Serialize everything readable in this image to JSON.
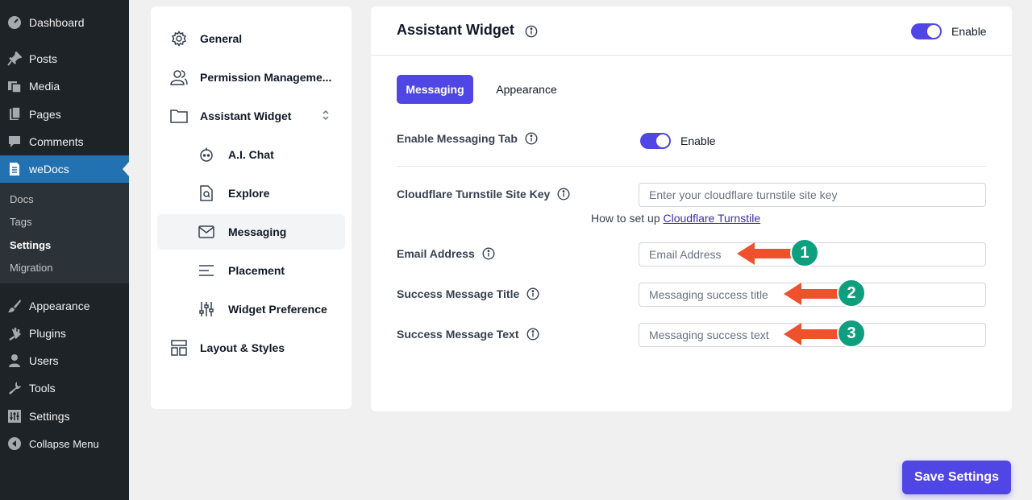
{
  "wp_menu": {
    "dashboard": "Dashboard",
    "posts": "Posts",
    "media": "Media",
    "pages": "Pages",
    "comments": "Comments",
    "wedocs": "weDocs",
    "submenu": [
      "Docs",
      "Tags",
      "Settings",
      "Migration"
    ],
    "appearance": "Appearance",
    "plugins": "Plugins",
    "users": "Users",
    "tools": "Tools",
    "settings": "Settings",
    "collapse": "Collapse Menu"
  },
  "settings_nav": {
    "general": "General",
    "permission": "Permission Manageme...",
    "assistant_widget": "Assistant Widget",
    "ai_chat": "A.I. Chat",
    "explore": "Explore",
    "messaging": "Messaging",
    "placement": "Placement",
    "widget_preference": "Widget Preference",
    "layout_styles": "Layout & Styles"
  },
  "main": {
    "title": "Assistant Widget",
    "header_toggle_label": "Enable",
    "tabs": [
      "Messaging",
      "Appearance"
    ],
    "enable_messaging_label": "Enable Messaging Tab",
    "enable_messaging_toggle_label": "Enable",
    "turnstile_label": "Cloudflare Turnstile Site Key",
    "turnstile_placeholder": "Enter your cloudflare turnstile site key",
    "help_prefix": "How to set up",
    "help_link": "Cloudflare Turnstile",
    "email_label": "Email Address",
    "email_placeholder": "Email Address",
    "success_title_label": "Success Message Title",
    "success_title_placeholder": "Messaging success title",
    "success_text_label": "Success Message Text",
    "success_text_placeholder": "Messaging success text"
  },
  "annotations": [
    "1",
    "2",
    "3"
  ],
  "save_button": "Save Settings",
  "colors": {
    "accent": "#4f46e5",
    "wp_active": "#2271b1",
    "arrow": "#f0512d",
    "badge": "#0e9f7e"
  }
}
